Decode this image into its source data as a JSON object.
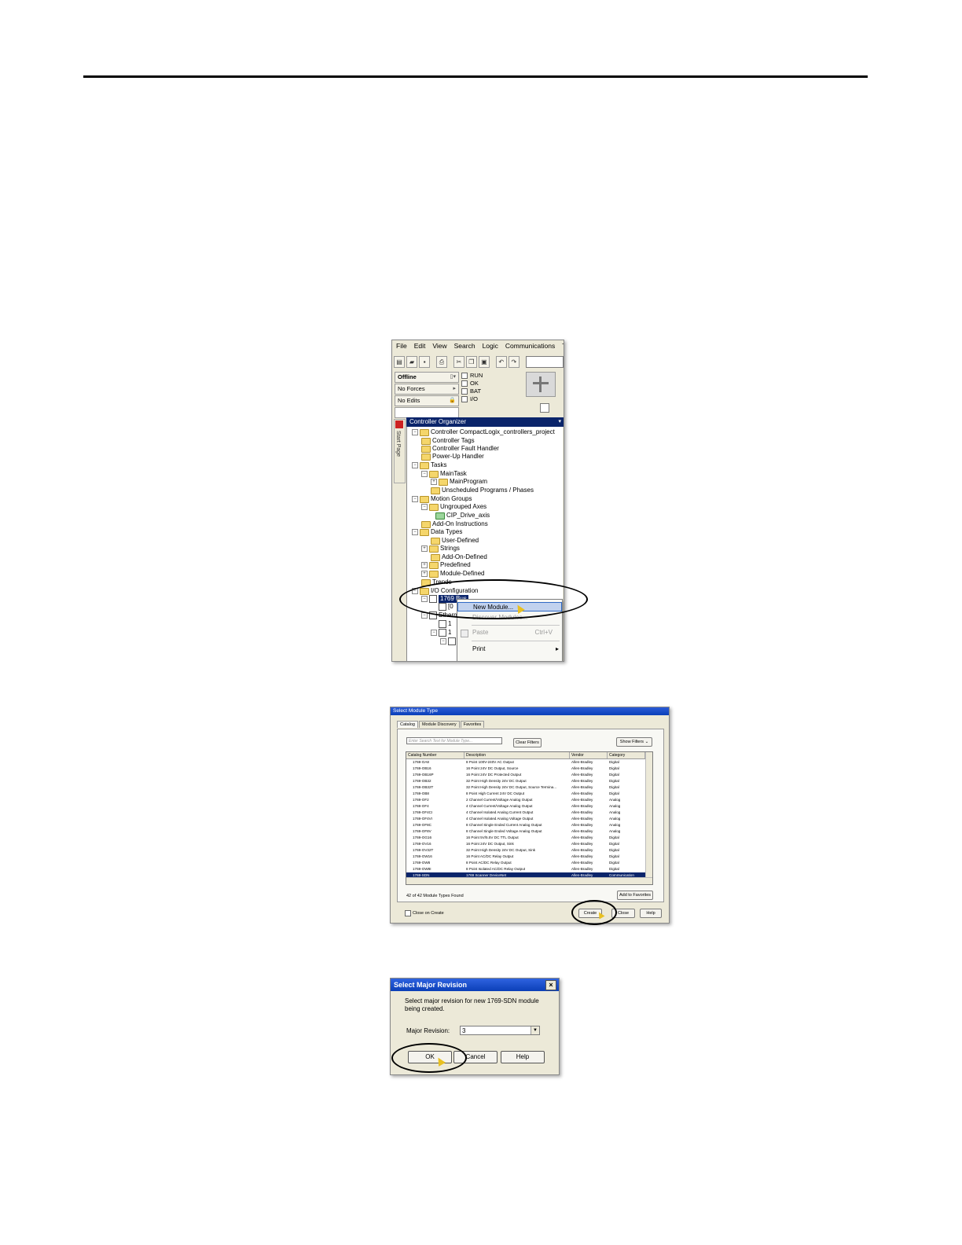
{
  "screenshot1": {
    "menu": [
      "File",
      "Edit",
      "View",
      "Search",
      "Logic",
      "Communications",
      "Te"
    ],
    "status": {
      "mode": "Offline",
      "forces": "No Forces",
      "edits": "No Edits"
    },
    "leds": [
      "RUN",
      "OK",
      "BAT",
      "I/O"
    ],
    "start_page_label": "Start Page",
    "organizer_title": "Controller Organizer",
    "tree": {
      "controller": "Controller CompactLogix_controllers_project",
      "controller_tags": "Controller Tags",
      "fault_handler": "Controller Fault Handler",
      "powerup_handler": "Power-Up Handler",
      "tasks": "Tasks",
      "main_task": "MainTask",
      "main_program": "MainProgram",
      "unscheduled": "Unscheduled Programs / Phases",
      "motion_groups": "Motion Groups",
      "ungrouped_axes": "Ungrouped Axes",
      "cip_drive": "CIP_Drive_axis",
      "add_on_instructions": "Add-On Instructions",
      "data_types": "Data Types",
      "user_defined": "User-Defined",
      "strings": "Strings",
      "add_on_defined": "Add-On-Defined",
      "predefined": "Predefined",
      "module_defined": "Module-Defined",
      "trends": "Trends",
      "io_config": "I/O Configuration",
      "bus_node": "1769 Bus",
      "sub_a": "[0",
      "ethernet": "Ethern",
      "sub_b": "1",
      "sub_c": "1"
    },
    "context_menu": {
      "new_module": "New Module...",
      "discover_modules": "Discover Modules...",
      "paste": "Paste",
      "paste_shortcut": "Ctrl+V",
      "print": "Print"
    }
  },
  "screenshot2": {
    "title": "Select Module Type",
    "tabs": [
      "Catalog",
      "Module Discovery",
      "Favorites"
    ],
    "search_placeholder": "Enter Search Text for Module Type...",
    "clear_filters": "Clear Filters",
    "show_filters": "Show Filters",
    "columns": [
      "Catalog Number",
      "Description",
      "Vendor",
      "Category"
    ],
    "rows": [
      [
        "1769-OA8",
        "8 Point 100V-240V AC Output",
        "Allen-Bradley",
        "Digital"
      ],
      [
        "1769-OB16",
        "16 Point 24V DC Output, Source",
        "Allen-Bradley",
        "Digital"
      ],
      [
        "1769-OB16P",
        "16 Point 24V DC Protected Output",
        "Allen-Bradley",
        "Digital"
      ],
      [
        "1769-OB32",
        "32 Point High Density 24V DC Output",
        "Allen-Bradley",
        "Digital"
      ],
      [
        "1769-OB32T",
        "32 Point High Density 24V DC Output, Source Termina...",
        "Allen-Bradley",
        "Digital"
      ],
      [
        "1769-OB8",
        "8 Point High Current 24V DC Output",
        "Allen-Bradley",
        "Digital"
      ],
      [
        "1769-OF2",
        "2 Channel Current/Voltage Analog Output",
        "Allen-Bradley",
        "Analog"
      ],
      [
        "1769-OF4",
        "4 Channel Current/Voltage Analog Output",
        "Allen-Bradley",
        "Analog"
      ],
      [
        "1769-OF4CI",
        "4 Channel Isolated Analog Current Output",
        "Allen-Bradley",
        "Analog"
      ],
      [
        "1769-OF4VI",
        "4 Channel Isolated Analog Voltage Output",
        "Allen-Bradley",
        "Analog"
      ],
      [
        "1769-OF8C",
        "8 Channel Single Ended Current Analog Output",
        "Allen-Bradley",
        "Analog"
      ],
      [
        "1769-OF8V",
        "8 Channel Single Ended Voltage Analog Output",
        "Allen-Bradley",
        "Analog"
      ],
      [
        "1769-OG16",
        "16 Point 5V/5.5V DC TTL Output",
        "Allen-Bradley",
        "Digital"
      ],
      [
        "1769-OV16",
        "16 Point 24V DC Output, Sink",
        "Allen-Bradley",
        "Digital"
      ],
      [
        "1769-OV32T",
        "32 Point High Density 24V DC Output, Sink",
        "Allen-Bradley",
        "Digital"
      ],
      [
        "1769-OW16",
        "16 Point AC/DC Relay Output",
        "Allen-Bradley",
        "Digital"
      ],
      [
        "1769-OW8",
        "8 Point AC/DC Relay Output",
        "Allen-Bradley",
        "Digital"
      ],
      [
        "1769-OW8I",
        "8 Point Isolated AC/DC Relay Output",
        "Allen-Bradley",
        "Digital"
      ],
      [
        "1769-SDN",
        "1769 Scanner DeviceNet",
        "Allen-Bradley",
        "Communication"
      ]
    ],
    "selected_row": 18,
    "found_text": "42  of 42 Module Types Found",
    "add_favorites": "Add to Favorites",
    "close_on_create": "Close on Create",
    "create": "Create",
    "close": "Close",
    "help": "Help"
  },
  "screenshot3": {
    "title": "Select Major Revision",
    "message": "Select major revision for new 1769-SDN module being created.",
    "label": "Major Revision:",
    "value": "3",
    "ok": "OK",
    "cancel": "Cancel",
    "help": "Help"
  },
  "colors": {
    "selection": "#0a246a",
    "titlebar": "#0a3fb8",
    "window_bg": "#ece9d8",
    "folder": "#f5d66b",
    "cursor": "#e8c021"
  }
}
